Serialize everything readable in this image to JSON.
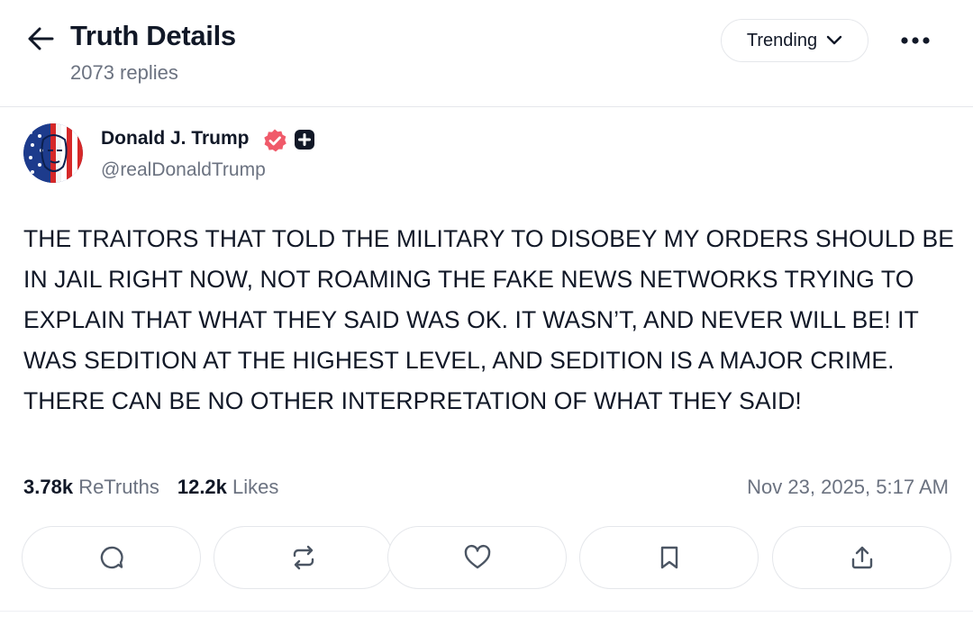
{
  "header": {
    "title": "Truth Details",
    "replies": "2073 replies",
    "sort_label": "Trending"
  },
  "post": {
    "author_name": "Donald J. Trump",
    "handle": "@realDonaldTrump",
    "text": "THE TRAITORS THAT TOLD THE MILITARY TO DISOBEY MY ORDERS SHOULD BE IN JAIL RIGHT NOW, NOT ROAMING THE FAKE NEWS NETWORKS TRYING TO EXPLAIN THAT WHAT THEY SAID WAS OK. IT WASN’T, AND NEVER WILL BE! IT WAS SEDITION AT THE HIGHEST LEVEL, AND SEDITION IS A MAJOR CRIME. THERE CAN BE NO OTHER INTERPRETATION OF WHAT THEY SAID!",
    "retruths_count": "3.78k",
    "retruths_label": "ReTruths",
    "likes_count": "12.2k",
    "likes_label": "Likes",
    "timestamp": "Nov 23, 2025, 5:17 AM"
  },
  "actions": [
    "reply-icon",
    "retruth-icon",
    "like-icon",
    "bookmark-icon",
    "share-icon"
  ],
  "colors": {
    "verified_badge": "#f05a6a",
    "text_primary": "#111827",
    "text_secondary": "#6b7280",
    "border": "#e5e7eb",
    "icon": "#4b5563"
  }
}
